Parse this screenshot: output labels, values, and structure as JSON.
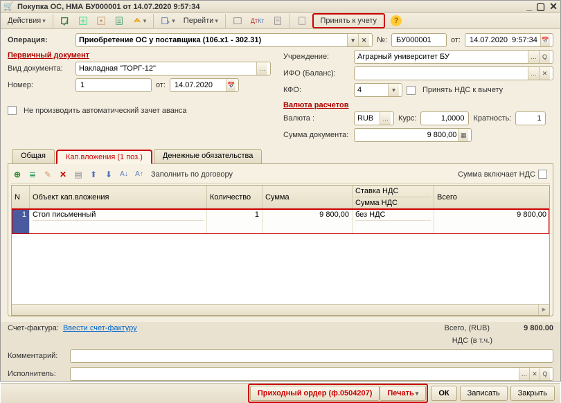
{
  "window": {
    "title": "Покупка ОС, НМА БУ000001 от 14.07.2020 9:57:34"
  },
  "toolbar": {
    "actions": "Действия",
    "go": "Перейти",
    "akkt": "Кт",
    "accept": "Принять к учету"
  },
  "header": {
    "operation_label": "Операция:",
    "operation_value": "Приобретение ОС у поставщика (106.х1 - 302.31)",
    "number_label": "№:",
    "number_value": "БУ000001",
    "date_label": "от:",
    "date_value": "14.07.2020  9:57:34"
  },
  "left": {
    "primary_doc": "Первичный документ",
    "doc_type_label": "Вид документа:",
    "doc_type_value": "Накладная \"ТОРГ-12\"",
    "number_label": "Номер:",
    "number_value": "1",
    "number_date_label": "от:",
    "number_date_value": "14.07.2020",
    "no_advance": "Не производить автоматический зачет аванса"
  },
  "right": {
    "institution_label": "Учреждение:",
    "institution_value": "Аграрный университет БУ",
    "ifo_label": "ИФО (Баланс):",
    "ifo_value": "",
    "kfo_label": "КФО:",
    "kfo_value": "4",
    "vat_deduct": "Принять НДС к вычету",
    "currency_section": "Валюта расчетов",
    "currency_label": "Валюта :",
    "currency_value": "RUB",
    "rate_label": "Курс:",
    "rate_value": "1,0000",
    "mult_label": "Кратность:",
    "mult_value": "1",
    "doc_sum_label": "Сумма документа:",
    "doc_sum_value": "9 800,00"
  },
  "tabs": {
    "general": "Общая",
    "capital": "Кап.вложения (1 поз.)",
    "liabilities": "Денежные обязательства"
  },
  "tabtoolbar": {
    "fill_by_contract": "Заполнить по договору",
    "sum_includes_vat": "Сумма включает НДС"
  },
  "grid": {
    "cols": {
      "n": "N",
      "object": "Объект кап.вложения",
      "qty": "Количество",
      "sum": "Сумма",
      "vat_rate": "Ставка НДС",
      "vat_sum": "Сумма НДС",
      "total": "Всего"
    },
    "rows": [
      {
        "n": "1",
        "object": "Стол письменный",
        "qty": "1",
        "sum": "9 800,00",
        "vat_rate": "без НДС",
        "vat_sum": "",
        "total": "9 800,00"
      }
    ]
  },
  "invoice": {
    "label": "Счет-фактура:",
    "link": "Ввести счет-фактуру"
  },
  "totals": {
    "total_label": "Всего, (RUB)",
    "total_value": "9 800.00",
    "vat_label": "НДС (в т.ч.)"
  },
  "comment_label": "Комментарий:",
  "performer_label": "Исполнитель:",
  "footer": {
    "receipt_order": "Приходный ордер (ф.0504207)",
    "print": "Печать",
    "ok": "ОК",
    "save": "Записать",
    "close": "Закрыть"
  }
}
